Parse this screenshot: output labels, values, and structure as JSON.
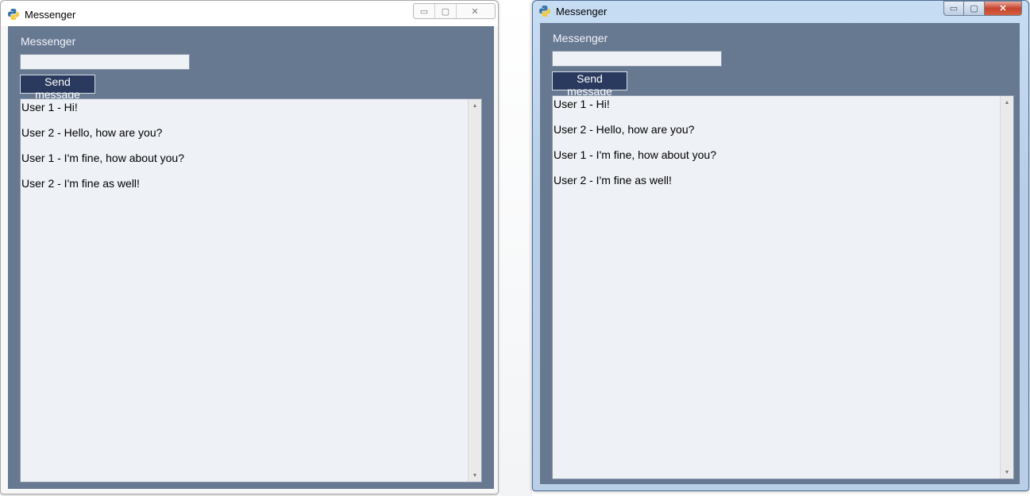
{
  "windows": [
    {
      "title": "Messenger",
      "controls": {
        "minimize": "▭",
        "maximize": "▢",
        "close": "✕"
      },
      "app_label": "Messenger",
      "input": {
        "value": "",
        "placeholder": ""
      },
      "send_button": "Send message",
      "messages": [
        "User 1 - Hi!",
        "User 2 - Hello, how are you?",
        "User 1 - I'm fine, how about you?",
        "User 2 - I'm fine as well!"
      ],
      "scroll_up": "▲",
      "scroll_down": "▼"
    },
    {
      "title": "Messenger",
      "controls": {
        "minimize": "▭",
        "maximize": "▢",
        "close": "✕"
      },
      "app_label": "Messenger",
      "input": {
        "value": "",
        "placeholder": ""
      },
      "send_button": "Send message",
      "messages": [
        "User 1 - Hi!",
        "User 2 - Hello, how are you?",
        "User 1 - I'm fine, how about you?",
        "User 2 - I'm fine as well!"
      ],
      "scroll_up": "▲",
      "scroll_down": "▼"
    }
  ],
  "colors": {
    "client_background": "#677891",
    "button_background": "#2a3a5e",
    "text_area_background": "#eef1f6",
    "close_button": "#c7442e"
  },
  "icons": {
    "app_icon": "python-logo-icon"
  }
}
